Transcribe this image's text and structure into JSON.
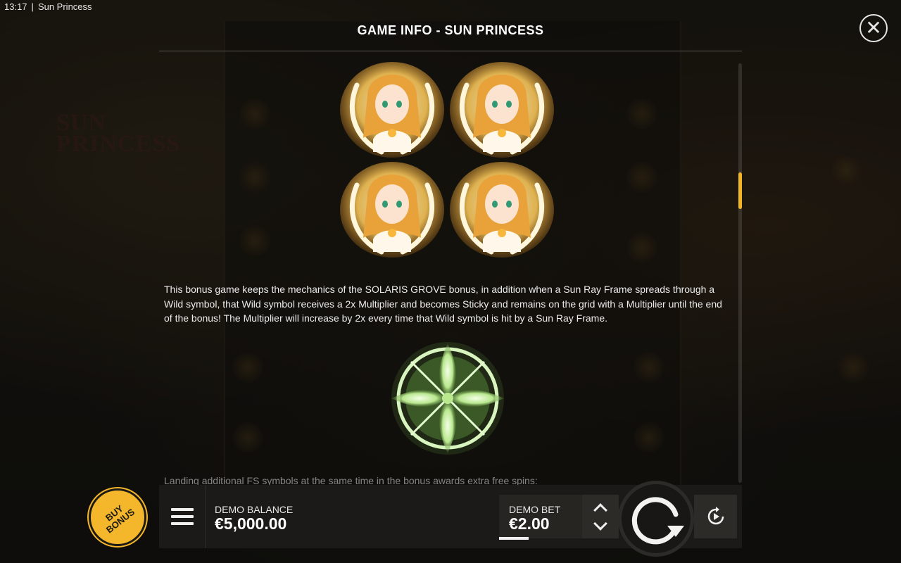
{
  "status_bar": {
    "time": "13:17",
    "separator": "|",
    "game_name": "Sun Princess"
  },
  "info_panel": {
    "title": "GAME INFO - SUN PRINCESS",
    "body_text": "This bonus game keeps the mechanics of the SOLARIS GROVE bonus, in addition when a Sun Ray Frame spreads through a Wild symbol, that Wild symbol receives a 2x Multiplier and becomes Sticky and remains on the grid with a Multiplier until the end of the bonus! The Multiplier will increase by 2x every time that Wild symbol is hit by a Sun Ray Frame.",
    "cut_off_text": "Landing additional FS symbols at the same time in the bonus awards extra free spins:",
    "symbols": [
      {
        "icon": "sun-princess-wild-icon"
      },
      {
        "icon": "sun-princess-wild-icon"
      },
      {
        "icon": "sun-princess-wild-icon"
      },
      {
        "icon": "sun-princess-wild-icon"
      },
      {
        "icon": "sun-ray-frame-icon"
      }
    ]
  },
  "controls": {
    "buy_bonus_label": "BUY BONUS",
    "balance_label": "DEMO BALANCE",
    "balance_value": "€5,000.00",
    "bet_label": "DEMO BET",
    "bet_value": "€2.00"
  },
  "colors": {
    "accent": "#f4b62a",
    "scrollbar": "#f2b624",
    "bar_background": "#1b1a18",
    "frame_glow": "#c8f0a0"
  }
}
